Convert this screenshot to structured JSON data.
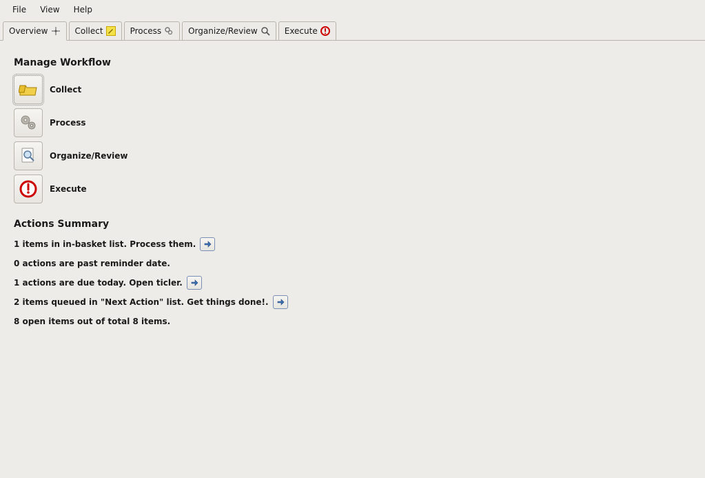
{
  "menu": {
    "file": "File",
    "view": "View",
    "help": "Help"
  },
  "tabs": [
    {
      "label": "Overview",
      "active": true
    },
    {
      "label": "Collect"
    },
    {
      "label": "Process"
    },
    {
      "label": "Organize/Review"
    },
    {
      "label": "Execute"
    }
  ],
  "workflow": {
    "title": "Manage Workflow",
    "items": [
      {
        "label": "Collect"
      },
      {
        "label": "Process"
      },
      {
        "label": "Organize/Review"
      },
      {
        "label": "Execute"
      }
    ]
  },
  "summary": {
    "title": "Actions Summary",
    "lines": [
      {
        "text": "1 items in in-basket list. Process them.",
        "has_goto": true
      },
      {
        "text": "0 actions are past reminder date.",
        "has_goto": false
      },
      {
        "text": "1 actions are due today. Open ticler.",
        "has_goto": true
      },
      {
        "text": "2 items queued in \"Next Action\" list. Get things done!.",
        "has_goto": true
      },
      {
        "text": "8 open items out of total 8 items.",
        "has_goto": false
      }
    ]
  }
}
